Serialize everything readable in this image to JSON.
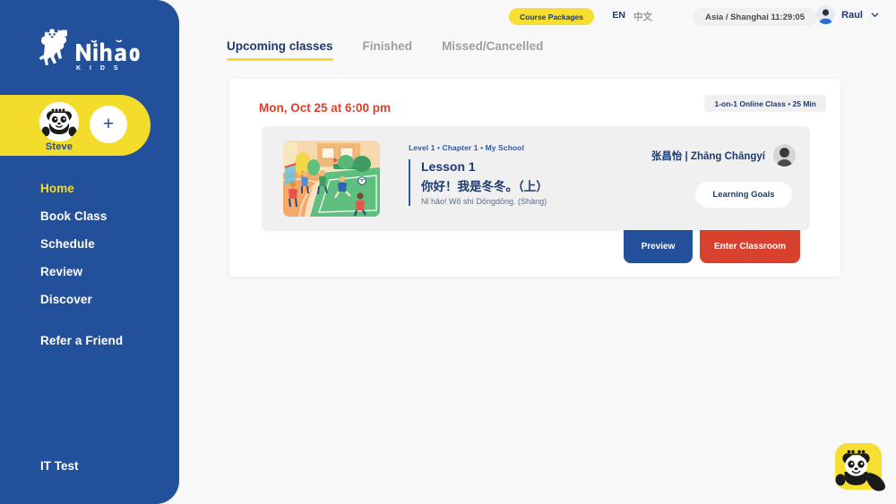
{
  "brand": {
    "logo_text": "Nǐhǎo",
    "logo_sub": "K I D S",
    "colors": {
      "sidebar_blue": "#23509B",
      "accent_yellow": "#F4DC2A",
      "danger_red": "#D9412F",
      "page_bg": "#F8F8F8",
      "panel_gray": "#F0F0F0"
    }
  },
  "sidebar": {
    "profile": {
      "kid_name": "Steve",
      "avatar_icon": "panda-avatar-icon",
      "add_label": "+"
    },
    "items": [
      {
        "label": "Home",
        "active": true
      },
      {
        "label": "Book Class",
        "active": false
      },
      {
        "label": "Schedule",
        "active": false
      },
      {
        "label": "Review",
        "active": false
      },
      {
        "label": "Discover",
        "active": false
      }
    ],
    "refer": {
      "label": "Refer a Friend"
    },
    "footer": {
      "label": "IT Test"
    }
  },
  "header": {
    "course_packages_label": "Course Packages",
    "lang_en": "EN",
    "lang_cn": "中文",
    "timezone": "Asia / Shanghai 11:29:05",
    "user_name": "Raul",
    "user_avatar_icon": "user-avatar-icon",
    "chevron_icon": "chevron-down-icon"
  },
  "tabs": [
    {
      "label": "Upcoming classes",
      "active": true
    },
    {
      "label": "Finished",
      "active": false
    },
    {
      "label": "Missed/Cancelled",
      "active": false
    }
  ],
  "class_card": {
    "date": "Mon, Oct 25 at 6:00 pm",
    "badge": "1-on-1 Online Class • 25 Min",
    "lesson": {
      "meta": "Level 1 • Chapter 1  • My School",
      "title": "Lesson 1",
      "chinese": "你好！我是冬冬。（上）",
      "pinyin": "Nǐ hǎo! Wǒ shì Dōngdōng. (Shàng)",
      "thumbnail_icon": "playground-illustration"
    },
    "teacher": {
      "name": "张昌怡 | Zhāng Chāngyí",
      "avatar_icon": "teacher-avatar-icon"
    },
    "learning_goals_label": "Learning Goals",
    "preview_label": "Preview",
    "enter_classroom_label": "Enter Classroom"
  },
  "chat_widget": {
    "icon": "panda-chat-icon"
  }
}
